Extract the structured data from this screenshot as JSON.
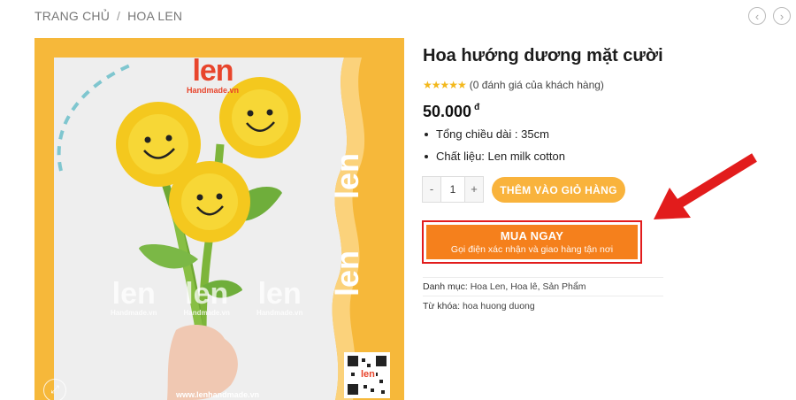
{
  "breadcrumb": {
    "home": "TRANG CHỦ",
    "separator": "/",
    "category": "HOA LEN"
  },
  "nav": {
    "prev_icon": "chevron-left-icon",
    "next_icon": "chevron-right-icon",
    "prev_glyph": "‹",
    "next_glyph": "›"
  },
  "image": {
    "logo_text": "len",
    "logo_sub": "Handmade.vn",
    "side_brand": "len",
    "side_brand_sub": "Handmade.vn",
    "watermark": [
      "len",
      "len",
      "len"
    ],
    "watermark_sub": "Handmade.vn",
    "website": "www.lenhandmade.vn",
    "qr_label": "len",
    "zoom_icon": "zoom-in-icon"
  },
  "product": {
    "title": "Hoa hướng dương mặt cười",
    "stars": "★★★★★",
    "rating_value": 0,
    "rating_text": "(0 đánh giá của khách hàng)",
    "price": "50.000",
    "currency": "đ",
    "specs": [
      "Tổng chiều dài : 35cm",
      "Chất liệu: Len milk cotton"
    ]
  },
  "cart": {
    "minus": "-",
    "plus": "+",
    "quantity": "1",
    "add_to_cart_label": "THÊM VÀO GIỎ HÀNG"
  },
  "buy_now": {
    "label": "MUA NGAY",
    "sublabel": "Gọi điện xác nhận và giao hàng tận nơi"
  },
  "meta": {
    "category_label": "Danh mục:",
    "categories": [
      "Hoa Len",
      "Hoa lê",
      "Sản Phẩm"
    ],
    "tags_label": "Từ khóa:",
    "tags": [
      "hoa huong duong"
    ]
  },
  "colors": {
    "accent_orange": "#f5801c",
    "cart_yellow": "#f9b33c",
    "highlight_red": "#e21c1c",
    "star": "#f3b81c",
    "brand_red": "#e8452c"
  }
}
